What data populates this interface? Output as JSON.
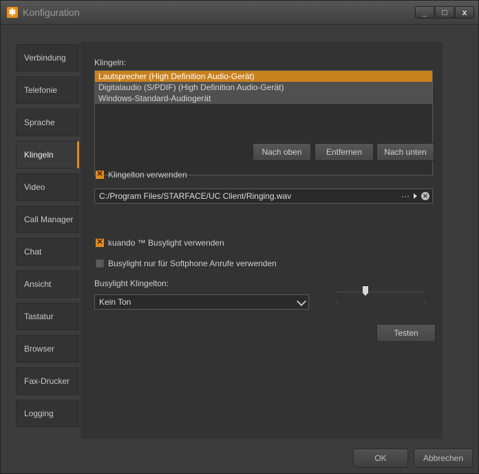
{
  "window": {
    "title": "Konfiguration",
    "app_icon": "starface-logo-icon",
    "controls": {
      "minimize": "_",
      "maximize": "□",
      "close": "x"
    }
  },
  "sidebar": {
    "items": [
      {
        "label": "Verbindung"
      },
      {
        "label": "Telefonie"
      },
      {
        "label": "Sprache"
      },
      {
        "label": "Klingeln",
        "active": true
      },
      {
        "label": "Video"
      },
      {
        "label": "Call Manager"
      },
      {
        "label": "Chat"
      },
      {
        "label": "Ansicht"
      },
      {
        "label": "Tastatur"
      },
      {
        "label": "Browser"
      },
      {
        "label": "Fax-Drucker"
      },
      {
        "label": "Logging"
      }
    ]
  },
  "main": {
    "klingeln_label": "Klingeln:",
    "devices": [
      "Lautsprecher (High Definition Audio-Gerät)",
      "Digitalaudio (S/PDIF) (High Definition Audio-Gerät)",
      "Windows-Standard-Audiogerät"
    ],
    "selected_device_index": 0,
    "buttons": {
      "up": "Nach oben",
      "remove": "Entfernen",
      "down": "Nach unten"
    },
    "ringtone_checkbox": {
      "label": "Klingelton verwenden",
      "checked": true
    },
    "ringtone_path": "C:/Program Files/STARFACE/UC Client/Ringing.wav",
    "path_more": "···",
    "busylight_checkbox": {
      "label": "kuando ™ Busylight verwenden",
      "checked": true
    },
    "busylight_softphone_checkbox": {
      "label": "Busylight nur für Softphone Anrufe verwenden",
      "checked": false
    },
    "busylight_ringtone_label": "Busylight Klingelton:",
    "busylight_ringtone_value": "Kein Ton",
    "volume_level": 0.3,
    "test_button": "Testen"
  },
  "footer": {
    "ok": "OK",
    "cancel": "Abbrechen"
  },
  "colors": {
    "accent": "#d98b22",
    "background": "#333333"
  }
}
